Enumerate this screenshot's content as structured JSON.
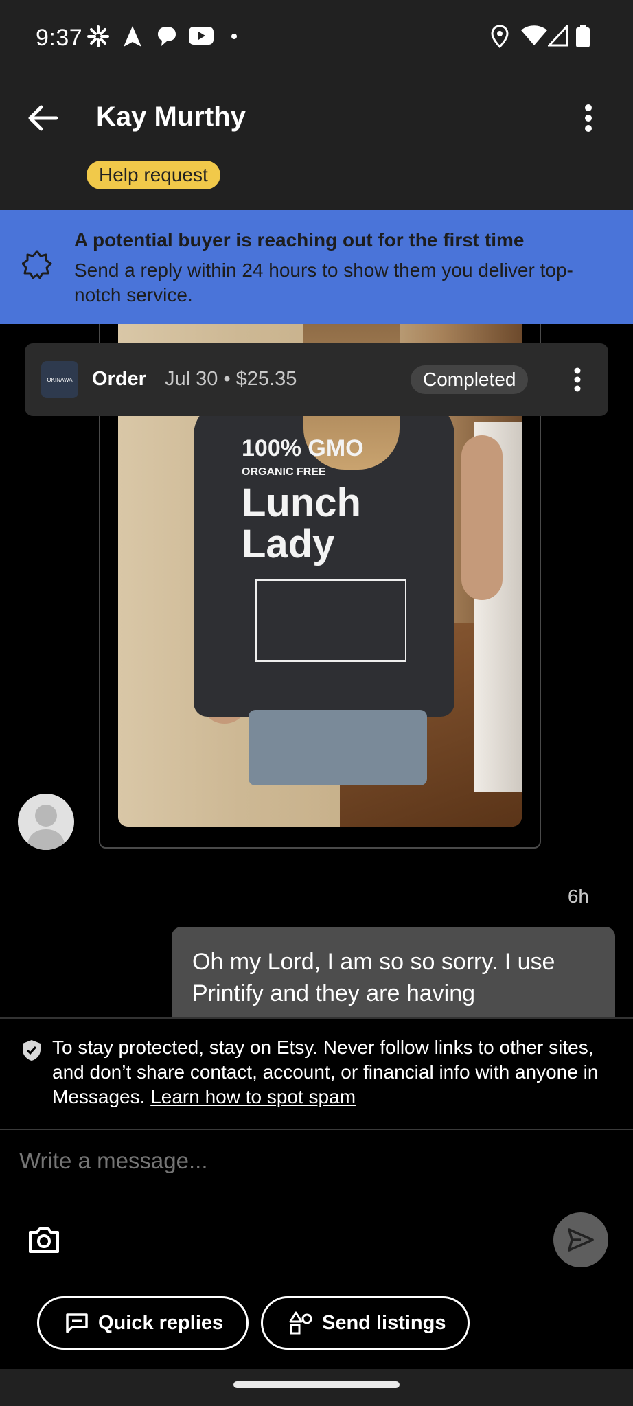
{
  "status_bar": {
    "time": "9:37",
    "left_icons": [
      "pinwheel-icon",
      "navigation-arrow-icon",
      "chat-bubble-icon",
      "youtube-icon",
      "dot-icon"
    ],
    "right_icons": [
      "location-pin-icon",
      "wifi-icon",
      "signal-icon",
      "battery-icon"
    ]
  },
  "app_bar": {
    "title": "Kay Murthy",
    "tag": "Help request",
    "tag_color": "#f1c94a"
  },
  "banner": {
    "title": "A potential buyer is reaching out for the first time",
    "body": "Send a reply within 24 hours to show them you deliver top-notch service.",
    "color": "#4a74d9"
  },
  "order": {
    "label": "Order",
    "meta": "Jul 30 • $25.35",
    "status": "Completed",
    "thumb_text": "OKINAWA"
  },
  "photo": {
    "shirt_line1": "100% GMO",
    "shirt_line2": "ORGANIC   FREE",
    "shirt_line3": "Lunch Lady"
  },
  "message": {
    "timestamp": "6h",
    "text": "Oh my Lord, I am so so sorry. I use Printify and they are having"
  },
  "notice": {
    "text": "To stay protected, stay on Etsy. Never follow links to other sites, and don’t share contact, account, or financial info with anyone in Messages.",
    "link": "Learn how to spot spam"
  },
  "composer": {
    "placeholder": "Write a message..."
  },
  "actions": {
    "quick_replies": "Quick replies",
    "send_listings": "Send listings"
  }
}
